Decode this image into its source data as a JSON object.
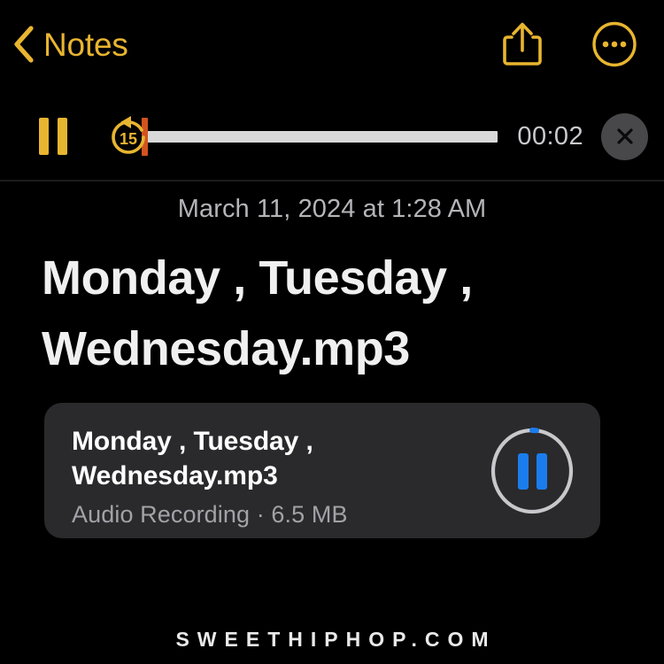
{
  "navbar": {
    "back_label": "Notes",
    "back_icon": "chevron-left-icon",
    "share_icon": "share-upload-icon",
    "more_icon": "more-circle-icon",
    "accent_color": "#e8b530"
  },
  "player": {
    "pause_icon": "pause-icon",
    "skip_back_icon": "skip-back-15-icon",
    "skip_back_label": "15",
    "elapsed_time": "00:02",
    "close_icon": "close-x-icon",
    "track_color": "#d9d9d9",
    "playhead_color": "#d2531f",
    "progress_percent": 0
  },
  "note": {
    "date": "March 11, 2024 at 1:28 AM",
    "title_line_1": "Monday , Tuesday ,",
    "title_line_2": "Wednesday.mp3"
  },
  "attachment": {
    "name_line_1": "Monday , Tuesday ,",
    "name_line_2": "Wednesday.mp3",
    "meta": "Audio Recording · 6.5 MB",
    "play_state_icon": "pause-icon",
    "ring_color": "#c8c8cc",
    "ring_progress_color": "#1b7ded",
    "ring_progress_percent": 2,
    "card_color": "#2a2a2c"
  },
  "footer": {
    "watermark": "SWEETHIPHOP.COM"
  }
}
